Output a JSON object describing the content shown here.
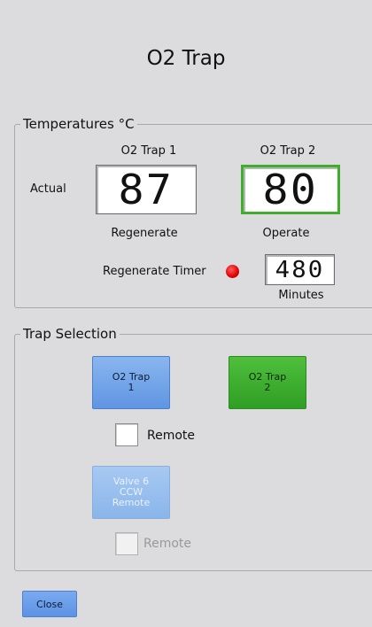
{
  "window": {
    "title": "O2 Trap"
  },
  "temperatures": {
    "legend": "Temperatures °C",
    "trap1_header": "O2 Trap 1",
    "trap2_header": "O2 Trap 2",
    "row_label": "Actual",
    "trap1_value": "87",
    "trap2_value": "80",
    "trap1_state": "Regenerate",
    "trap2_state": "Operate",
    "timer_label": "Regenerate Timer",
    "timer_indicator_color": "#e00000",
    "timer_value": "480",
    "timer_units": "Minutes",
    "active_border_color": "#3fae2a"
  },
  "trap_selection": {
    "legend": "Trap Selection",
    "trap1_button": "O2 Trap\n1",
    "trap2_button": "O2 Trap\n2",
    "remote_label": "Remote",
    "remote_checked": false,
    "valve_button": "Valve 6\nCCW\nRemote",
    "valve_remote_label": "Remote",
    "valve_remote_checked": false
  },
  "footer": {
    "close_label": "Close"
  },
  "colors": {
    "background": "#dcdbdd",
    "button_blue": "#6b9fe6",
    "button_green": "#3caf2e"
  }
}
